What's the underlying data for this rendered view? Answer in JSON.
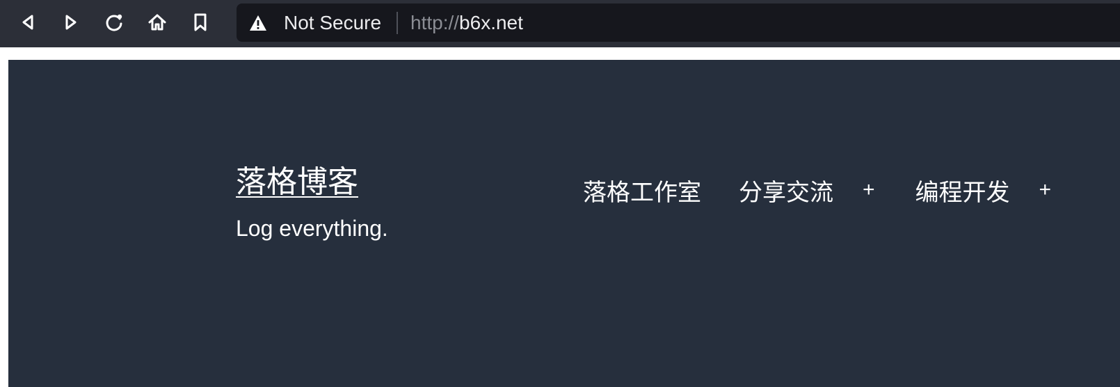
{
  "browser": {
    "toolbar_buttons": {
      "back": "back-icon",
      "forward": "forward-icon",
      "reload": "reload-icon",
      "home": "home-icon",
      "bookmark": "bookmark-icon"
    },
    "security_icon": "warning-icon",
    "security_label": "Not Secure",
    "url_scheme": "http://",
    "url_host": "b6x.net",
    "colors": {
      "toolbar_bg": "#2c2f38",
      "address_bg": "#16171d",
      "page_bg": "#262f3d"
    }
  },
  "site": {
    "title": "落格博客",
    "tagline": "Log everything."
  },
  "nav": {
    "items": [
      {
        "label": "落格工作室"
      },
      {
        "label": "分享交流",
        "expander": "+"
      },
      {
        "label": "编程开发",
        "expander": "+"
      }
    ]
  }
}
